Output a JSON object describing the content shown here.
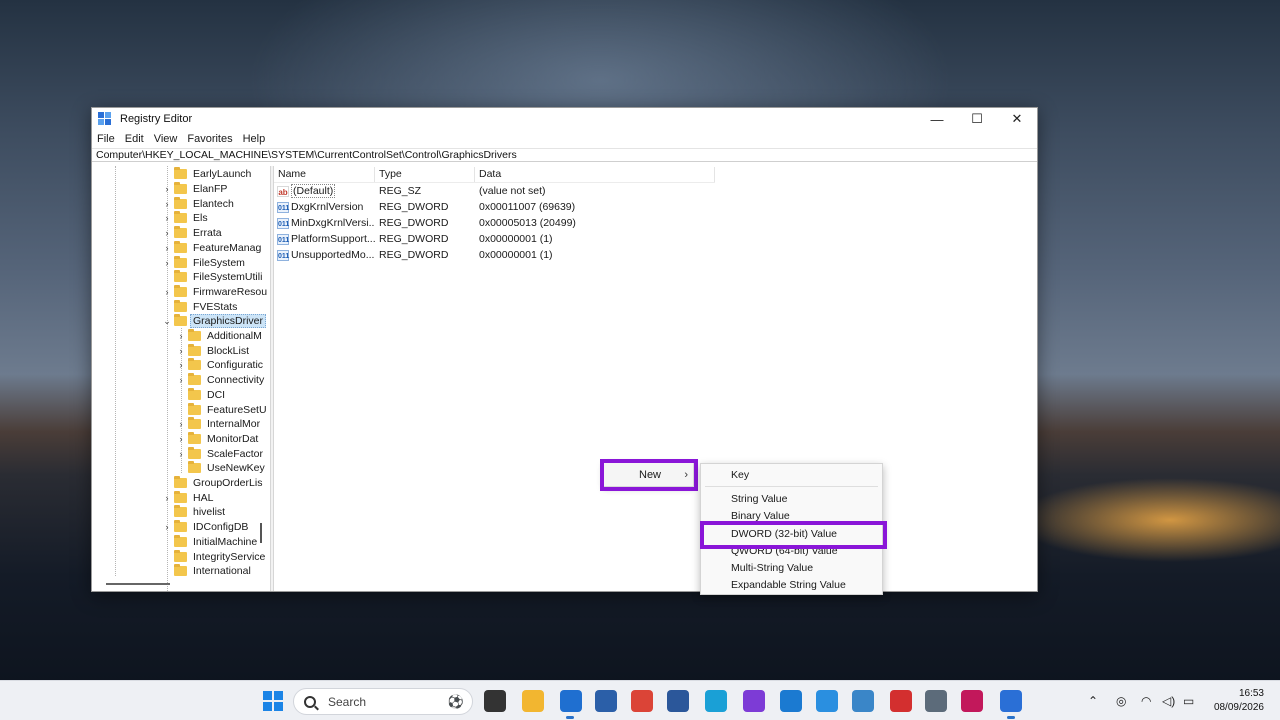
{
  "window": {
    "title": "Registry Editor",
    "controls": {
      "minimize": "—",
      "maximize": "☐",
      "close": "✕"
    }
  },
  "menubar": [
    {
      "label": "File"
    },
    {
      "label": "Edit"
    },
    {
      "label": "View"
    },
    {
      "label": "Favorites"
    },
    {
      "label": "Help"
    }
  ],
  "address": "Computer\\HKEY_LOCAL_MACHINE\\SYSTEM\\CurrentControlSet\\Control\\GraphicsDrivers",
  "tree": {
    "items": [
      {
        "label": "EarlyLaunch",
        "level": 1,
        "expander": ""
      },
      {
        "label": "ElanFP",
        "level": 1,
        "expander": "›"
      },
      {
        "label": "Elantech",
        "level": 1,
        "expander": "›"
      },
      {
        "label": "Els",
        "level": 1,
        "expander": "›"
      },
      {
        "label": "Errata",
        "level": 1,
        "expander": "›"
      },
      {
        "label": "FeatureManag",
        "level": 1,
        "expander": "›"
      },
      {
        "label": "FileSystem",
        "level": 1,
        "expander": "›"
      },
      {
        "label": "FileSystemUtili",
        "level": 1,
        "expander": ""
      },
      {
        "label": "FirmwareResou",
        "level": 1,
        "expander": "›"
      },
      {
        "label": "FVEStats",
        "level": 1,
        "expander": ""
      },
      {
        "label": "GraphicsDriver",
        "level": 1,
        "expander": "⌄",
        "selected": true
      },
      {
        "label": "AdditionalM",
        "level": 2,
        "expander": "›"
      },
      {
        "label": "BlockList",
        "level": 2,
        "expander": "›"
      },
      {
        "label": "Configuratic",
        "level": 2,
        "expander": "›"
      },
      {
        "label": "Connectivity",
        "level": 2,
        "expander": "›"
      },
      {
        "label": "DCI",
        "level": 2,
        "expander": ""
      },
      {
        "label": "FeatureSetU",
        "level": 2,
        "expander": ""
      },
      {
        "label": "InternalMor",
        "level": 2,
        "expander": "›"
      },
      {
        "label": "MonitorDat",
        "level": 2,
        "expander": "›"
      },
      {
        "label": "ScaleFactor",
        "level": 2,
        "expander": "›"
      },
      {
        "label": "UseNewKey",
        "level": 2,
        "expander": ""
      },
      {
        "label": "GroupOrderLis",
        "level": 1,
        "expander": ""
      },
      {
        "label": "HAL",
        "level": 1,
        "expander": "›"
      },
      {
        "label": "hivelist",
        "level": 1,
        "expander": ""
      },
      {
        "label": "IDConfigDB",
        "level": 1,
        "expander": "›"
      },
      {
        "label": "InitialMachine",
        "level": 1,
        "expander": ""
      },
      {
        "label": "IntegrityService",
        "level": 1,
        "expander": ""
      },
      {
        "label": "International",
        "level": 1,
        "expander": ""
      }
    ]
  },
  "values": {
    "columns": {
      "name": "Name",
      "type": "Type",
      "data": "Data"
    },
    "rows": [
      {
        "name": "(Default)",
        "type": "REG_SZ",
        "data": "(value not set)",
        "icon": "ab",
        "icon_kind": "string"
      },
      {
        "name": "DxgKrnlVersion",
        "type": "REG_DWORD",
        "data": "0x00011007 (69639)",
        "icon": "011",
        "icon_kind": "binary"
      },
      {
        "name": "MinDxgKrnlVersi...",
        "type": "REG_DWORD",
        "data": "0x00005013 (20499)",
        "icon": "011",
        "icon_kind": "binary"
      },
      {
        "name": "PlatformSupport...",
        "type": "REG_DWORD",
        "data": "0x00000001 (1)",
        "icon": "011",
        "icon_kind": "binary"
      },
      {
        "name": "UnsupportedMo...",
        "type": "REG_DWORD",
        "data": "0x00000001 (1)",
        "icon": "011",
        "icon_kind": "binary"
      }
    ]
  },
  "context_menu": {
    "new_label": "New",
    "arrow": "›",
    "submenu": [
      {
        "label": "Key"
      },
      {
        "label": "String Value"
      },
      {
        "label": "Binary Value"
      },
      {
        "label": "DWORD (32-bit) Value"
      },
      {
        "label": "QWORD (64-bit) Value"
      },
      {
        "label": "Multi-String Value"
      },
      {
        "label": "Expandable String Value"
      }
    ],
    "highlight_color": "#8a16d8"
  },
  "taskbar": {
    "search_placeholder": "Search",
    "pinned": [
      {
        "name": "task-view-icon",
        "color": "#333333"
      },
      {
        "name": "file-explorer-icon",
        "color": "#f2b630"
      },
      {
        "name": "outlook-icon",
        "color": "#1f6fd0"
      },
      {
        "name": "store-icon",
        "color": "#2b5fa8"
      },
      {
        "name": "chrome-icon",
        "color": "#db4437"
      },
      {
        "name": "word-icon",
        "color": "#2b579a"
      },
      {
        "name": "edge-icon",
        "color": "#1aa0d6"
      },
      {
        "name": "app-icon",
        "color": "#7d3bd6"
      },
      {
        "name": "photos-icon",
        "color": "#1b7ad1"
      },
      {
        "name": "sync-icon",
        "color": "#2a8fe0"
      },
      {
        "name": "control-panel-icon",
        "color": "#3a86c8"
      },
      {
        "name": "acrobat-icon",
        "color": "#d32f2f"
      },
      {
        "name": "settings-icon",
        "color": "#5c6b7a"
      },
      {
        "name": "snipping-tool-icon",
        "color": "#c2185b"
      },
      {
        "name": "registry-editor-icon",
        "color": "#2a6fd6"
      }
    ],
    "time": "16:53",
    "date": "08/09/2026"
  }
}
